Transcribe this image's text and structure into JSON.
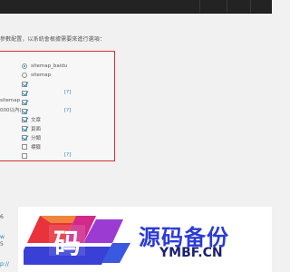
{
  "intro_text": "參數配置，以系統會根據需要來進行選項：",
  "side_labels": [
    "sitemap",
    "000以內)"
  ],
  "options": [
    {
      "type": "radio",
      "checked": true,
      "label": "sitemap_baidu",
      "help": ""
    },
    {
      "type": "radio",
      "checked": false,
      "label": "sitemap",
      "help": ""
    },
    {
      "type": "checkbox",
      "checked": true,
      "label": "",
      "help": ""
    },
    {
      "type": "checkbox",
      "checked": true,
      "label": "",
      "help": "[?]"
    },
    {
      "type": "checkbox",
      "checked": true,
      "label": "",
      "help": ""
    },
    {
      "type": "checkbox",
      "checked": true,
      "label": "",
      "help": "[?]"
    },
    {
      "type": "checkbox",
      "checked": true,
      "label": "文章",
      "help": ""
    },
    {
      "type": "checkbox",
      "checked": true,
      "label": "頁面",
      "help": ""
    },
    {
      "type": "checkbox",
      "checked": true,
      "label": "分類",
      "help": ""
    },
    {
      "type": "checkbox",
      "checked": false,
      "label": "標籤",
      "help": ""
    },
    {
      "type": "checkbox",
      "checked": false,
      "label": "",
      "help": "[?]"
    }
  ],
  "bottom_left": {
    "link": "p://",
    "link2": "w",
    "num1": "6",
    "num2": "5"
  },
  "watermark": {
    "title": "源码备份",
    "subtitle": "YMBF.CN",
    "logo_glyph": "码"
  },
  "colors": {
    "panel_border": "#d32f3a",
    "accent": "#1e8cbe",
    "link": "#2a7fba",
    "wm_blue": "#2b3bd6"
  }
}
